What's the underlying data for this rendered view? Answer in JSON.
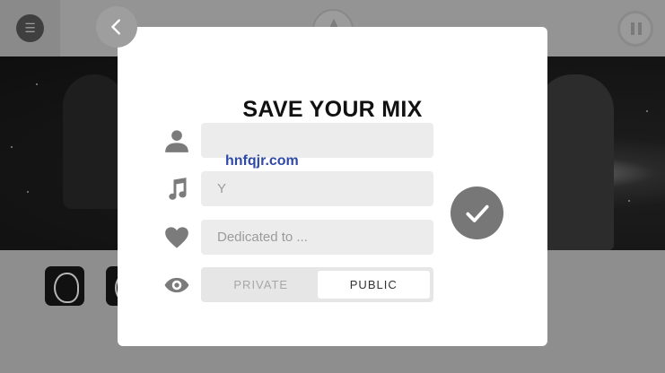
{
  "modal": {
    "title": "SAVE YOUR MIX",
    "fields": {
      "name": {
        "value": "",
        "placeholder": ""
      },
      "title": {
        "value": "",
        "placeholder": "Y"
      },
      "dedication": {
        "value": "",
        "placeholder": "Dedicated to ..."
      }
    },
    "overlay_text": "hnfqjr.com",
    "visibility": {
      "options": [
        "PRIVATE",
        "PUBLIC"
      ],
      "selected": "PUBLIC"
    }
  },
  "icons": {
    "menu": "menu-icon",
    "back": "chevron-left-icon",
    "logo": "app-logo-icon",
    "pause": "pause-icon",
    "user": "user-icon",
    "music": "music-note-icon",
    "heart": "heart-icon",
    "eye": "eye-icon",
    "confirm": "checkmark-icon"
  },
  "colors": {
    "overlay_dim": "#949494",
    "modal_bg": "#ffffff",
    "field_bg": "#ececec",
    "icon_gray": "#7b7b7b",
    "confirm_bg": "#777777",
    "overlay_text": "#2e49a8"
  }
}
